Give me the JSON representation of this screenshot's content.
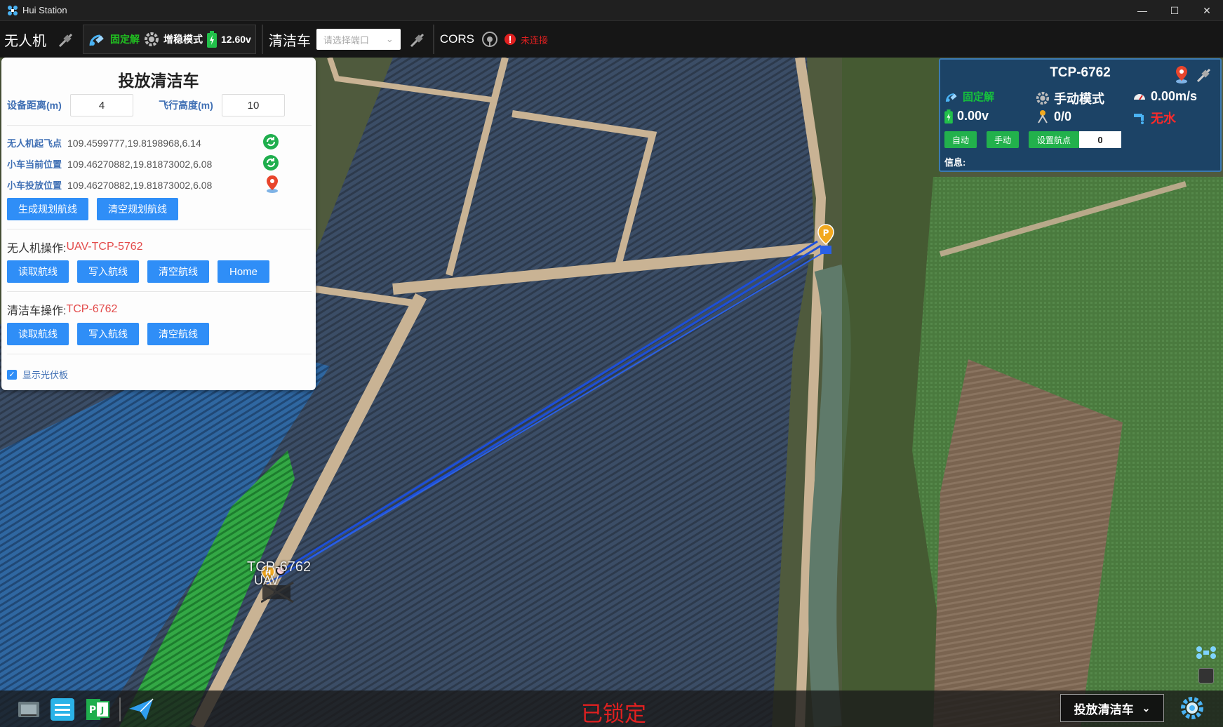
{
  "window": {
    "title": "Hui Station",
    "controls": [
      "minimize-icon",
      "maximize-icon",
      "close-icon"
    ]
  },
  "toolbar": {
    "drone_label": "无人机",
    "fix_status": "固定解",
    "mode": "增稳模式",
    "voltage": "12.60v",
    "cleaner_label": "清洁车",
    "port_placeholder": "请选择端口",
    "cors_label": "CORS",
    "cors_status": "未连接"
  },
  "left_panel": {
    "title": "投放清洁车",
    "distance_label": "设备距离(m)",
    "distance_value": "4",
    "height_label": "飞行高度(m)",
    "height_value": "10",
    "takeoff_label": "无人机起飞点",
    "takeoff_value": "109.4599777,19.8198968,6.14",
    "car_pos_label": "小车当前位置",
    "car_pos_value": "109.46270882,19.81873002,6.08",
    "drop_pos_label": "小车投放位置",
    "drop_pos_value": "109.46270882,19.81873002,6.08",
    "gen_route_btn": "生成规划航线",
    "clear_plan_btn": "清空规划航线",
    "uav_op_label": "无人机操作:",
    "uav_name": "UAV-TCP-5762",
    "uav_buttons": [
      "读取航线",
      "写入航线",
      "清空航线",
      "Home"
    ],
    "car_op_label": "清洁车操作:",
    "car_name": "TCP-6762",
    "car_buttons": [
      "读取航线",
      "写入航线",
      "清空航线"
    ],
    "show_panels_label": "显示光伏板",
    "show_panels_checked": true
  },
  "right_panel": {
    "title": "TCP-6762",
    "fix_status": "固定解",
    "mode": "手动模式",
    "speed": "0.00m/s",
    "voltage": "0.00v",
    "waypoints": "0/0",
    "water": "无水",
    "auto_btn": "自动",
    "manual_btn": "手动",
    "set_waypoint_btn": "设置航点",
    "waypoint_input": "0",
    "info_label": "信息:"
  },
  "map": {
    "marker_label": "TCP-6762",
    "uav_label": "UAV"
  },
  "bottom": {
    "lock_status": "已锁定",
    "mode_select": "投放清洁车"
  },
  "colors": {
    "accent_blue": "#2f8ef7",
    "status_green": "#22b14c",
    "alert_red": "#e02020",
    "panel_navy": "#1c4366"
  }
}
